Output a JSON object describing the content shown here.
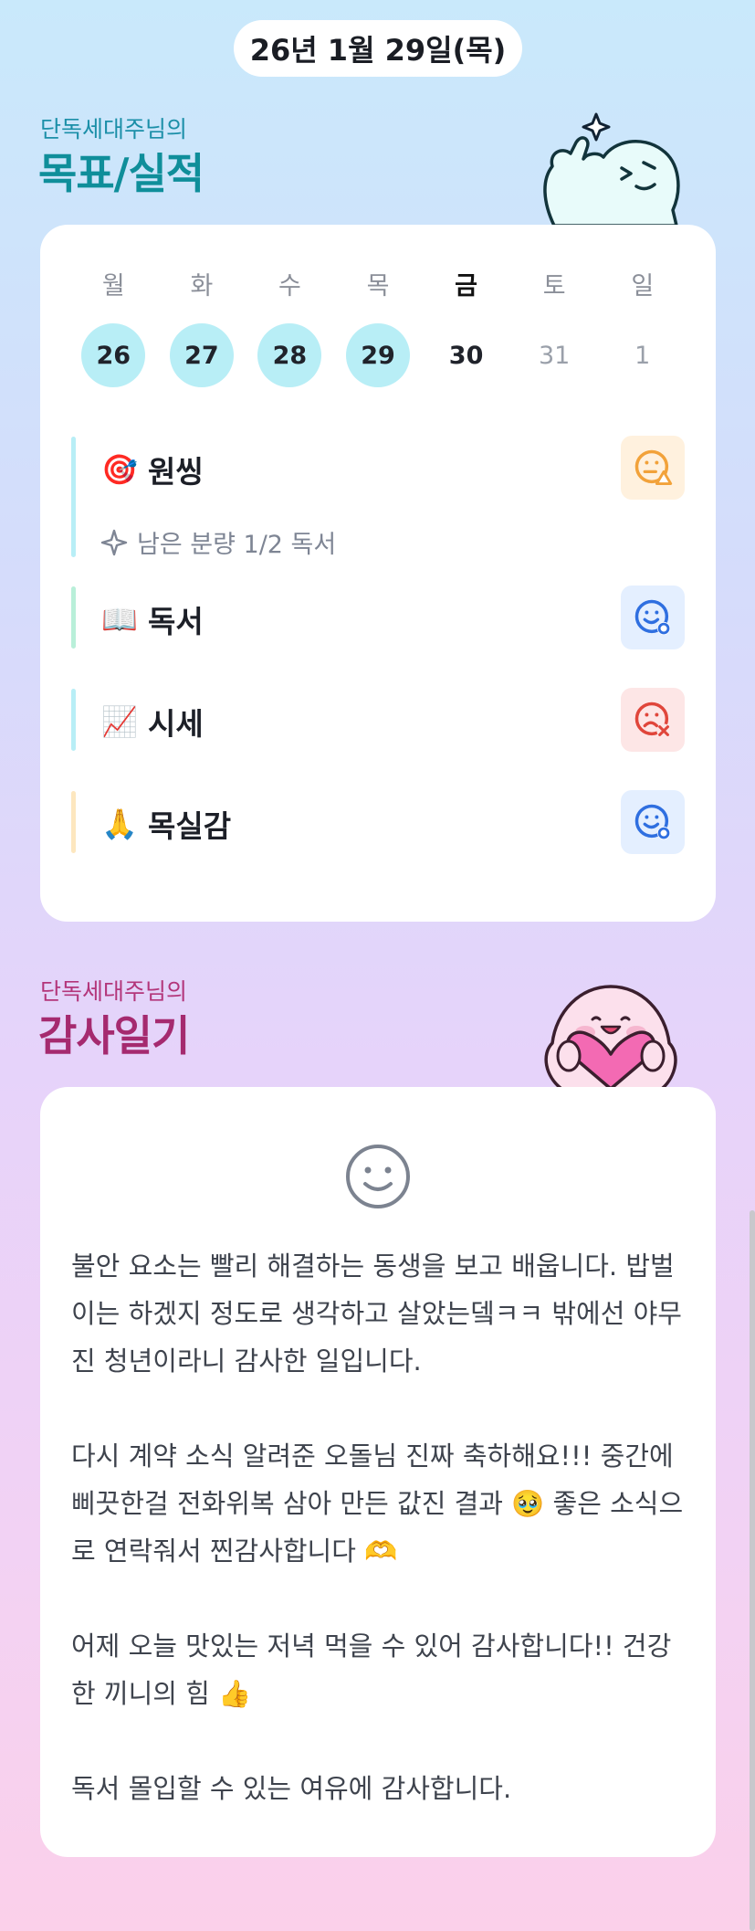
{
  "date": "26년 1월 29일(목)",
  "goals_section": {
    "subtitle": "단독세대주님의",
    "title": "목표/실적"
  },
  "calendar": {
    "days": [
      {
        "name": "월",
        "num": "26",
        "state": "done"
      },
      {
        "name": "화",
        "num": "27",
        "state": "done"
      },
      {
        "name": "수",
        "num": "28",
        "state": "done"
      },
      {
        "name": "목",
        "num": "29",
        "state": "done"
      },
      {
        "name": "금",
        "num": "30",
        "state": "today"
      },
      {
        "name": "토",
        "num": "31",
        "state": "future"
      },
      {
        "name": "일",
        "num": "1",
        "state": "future"
      }
    ]
  },
  "goals": [
    {
      "emoji": "🎯",
      "name": "원씽",
      "bar_color": "#b8eef6",
      "status": "warning",
      "status_bg": "#fff1de",
      "status_color": "#f2a23a",
      "remaining": "남은 분량 1/2 독서"
    },
    {
      "emoji": "📖",
      "name": "독서",
      "bar_color": "#b9efd9",
      "status": "done",
      "status_bg": "#e4efff",
      "status_color": "#2f6fe0"
    },
    {
      "emoji": "📈",
      "name": "시세",
      "bar_color": "#b8eef6",
      "status": "failed",
      "status_bg": "#fde6e6",
      "status_color": "#e0463b"
    },
    {
      "emoji": "🙏",
      "name": "목실감",
      "bar_color": "#fde7bf",
      "status": "done",
      "status_bg": "#e4efff",
      "status_color": "#2f6fe0"
    }
  ],
  "thanks_section": {
    "subtitle": "단독세대주님의",
    "title": "감사일기"
  },
  "thanks_entries": [
    "불안 요소는 빨리 해결하는 동생을 보고 배웁니다. 밥벌이는 하겠지 정도로 생각하고 살았는뎈ㅋㅋ 밖에선 야무진 청년이라니 감사한 일입니다.",
    "다시 계약 소식 알려준 오돌님 진짜 축하해요!!! 중간에 삐끗한걸 전화위복 삼아 만든 값진 결과 🥹 좋은 소식으로 연락줘서 찐감사합니다 🫶",
    "어제 오늘 맛있는 저녁 먹을 수 있어 감사합니다!! 건강한 끼니의 힘 👍",
    "독서 몰입할 수 있는 여유에 감사합니다."
  ]
}
